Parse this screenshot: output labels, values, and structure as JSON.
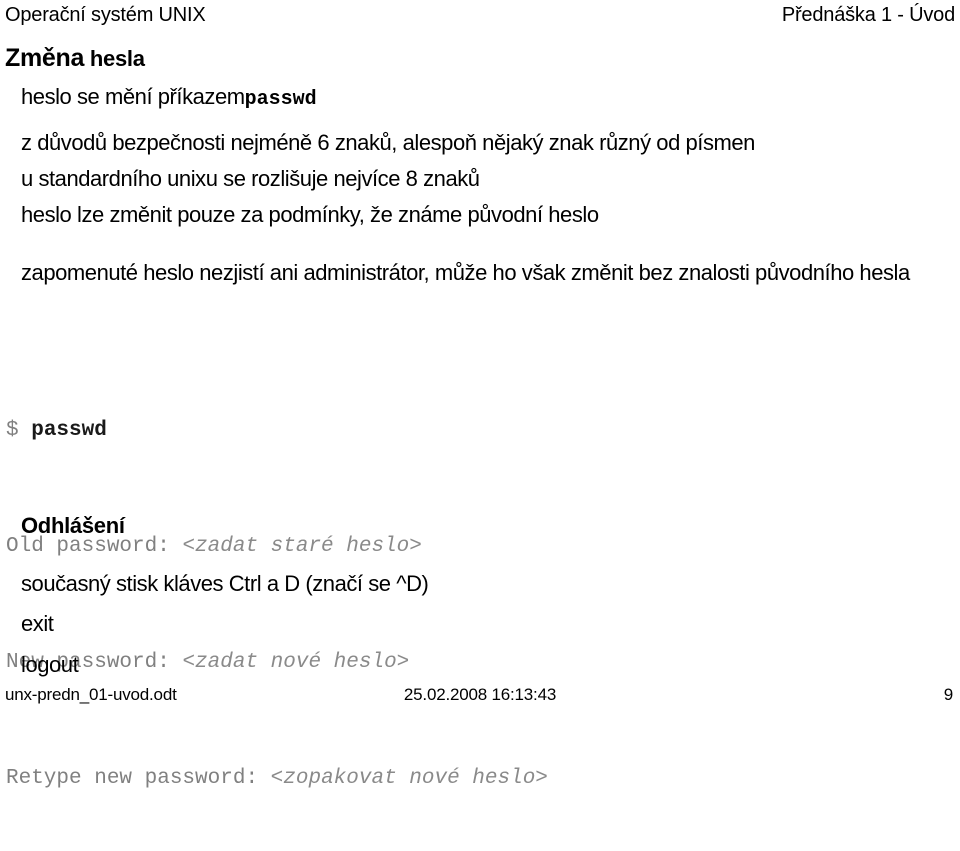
{
  "header": {
    "left": "Operační systém UNIX",
    "right": "Přednáška 1 - Úvod"
  },
  "sections": {
    "password_change": {
      "heading_main": "Změna",
      "heading_sub": "hesla",
      "bullets": [
        {
          "text_before": "heslo se mění příkazem",
          "code": "passwd",
          "text_after": ""
        },
        {
          "text": "z důvodů bezpečnosti nejméně 6 znaků, alespoň nějaký znak různý od písmen"
        },
        {
          "text": "u standardního unixu se rozlišuje nejvíce 8 znaků"
        },
        {
          "text": "heslo lze změnit pouze za podmínky, že známe původní heslo"
        },
        {
          "text": "zapomenuté heslo nezjistí ani administrátor, může ho však změnit bez znalosti původního hesla"
        }
      ]
    },
    "terminal": {
      "lines": [
        {
          "prompt": "$ ",
          "command": "passwd",
          "placeholder": ""
        },
        {
          "prompt": "Old password: ",
          "command": "",
          "placeholder": "<zadat staré heslo>"
        },
        {
          "prompt": "New password: ",
          "command": "",
          "placeholder": "<zadat nové heslo>"
        },
        {
          "prompt": "Retype new password: ",
          "command": "",
          "placeholder": "<zopakovat nové heslo>"
        }
      ]
    },
    "logout": {
      "heading": "Odhlášení",
      "bullets": [
        "současný stisk kláves Ctrl a D (značí se ^D)",
        "exit",
        "logout"
      ]
    }
  },
  "footer": {
    "filename": "unx-predn_01-uvod.odt",
    "timestamp": "25.02.2008 16:13:43",
    "page_number": "9"
  },
  "colors": {
    "background": "#ffffff",
    "text": "#000000",
    "terminal_text": "#808080",
    "terminal_command": "#1a1a1a"
  }
}
